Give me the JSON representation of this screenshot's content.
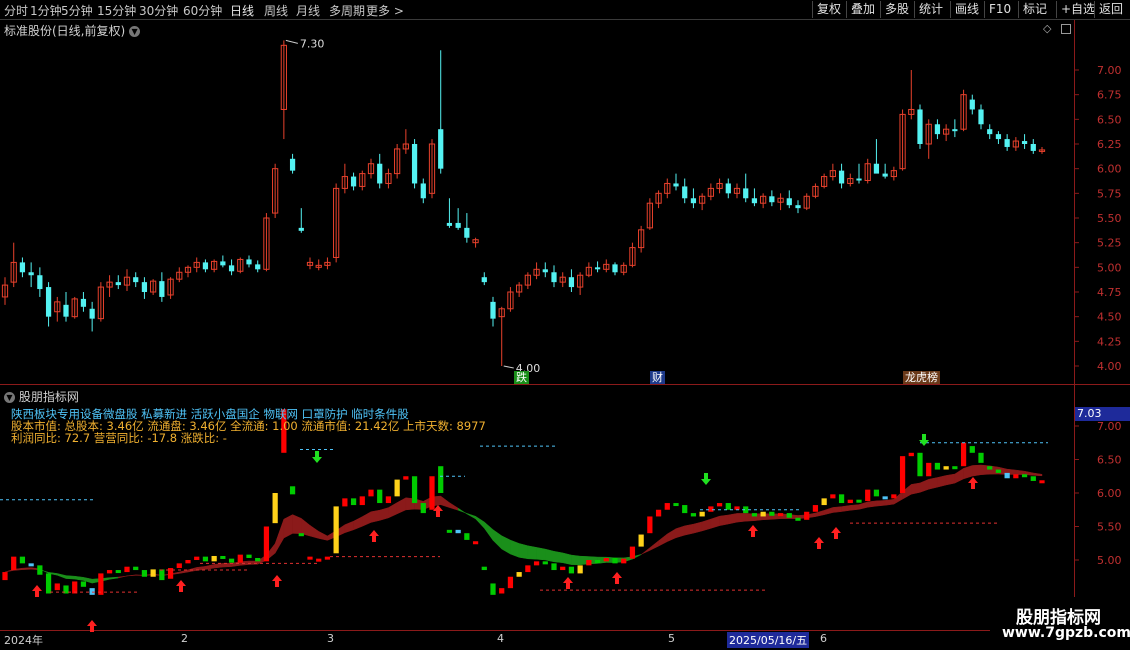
{
  "topbar": {
    "periods": [
      "分时",
      "1分钟",
      "5分钟",
      "15分钟",
      "30分钟",
      "60分钟",
      "日线",
      "周线",
      "月线",
      "多周期",
      "更多 >"
    ],
    "active_period": "日线",
    "tools": [
      "复权",
      "叠加",
      "多股",
      "统计",
      "画线",
      "F10",
      "标记",
      "+自选",
      "返回"
    ]
  },
  "price_panel": {
    "title": "标准股份(日线,前复权)",
    "y_ticks": [
      "7.00",
      "6.75",
      "6.50",
      "6.25",
      "6.00",
      "5.75",
      "5.50",
      "5.25",
      "5.00",
      "4.75",
      "4.50",
      "4.25",
      "4.00"
    ],
    "high_label": "7.30",
    "low_label": "4.00",
    "event_tags": [
      {
        "text": "跌",
        "color": "#1a8f1a"
      },
      {
        "text": "财",
        "color": "#1e3a8a"
      },
      {
        "text": "龙虎榜",
        "color": "#6b3a1a"
      }
    ]
  },
  "indicator_panel": {
    "title": "股朋指标网",
    "current_value": "7.03",
    "y_ticks": [
      "7.00",
      "6.50",
      "6.00",
      "5.50",
      "5.00"
    ],
    "info_lines": [
      {
        "text": "陕西板块专用设备微盘股 私募新进 活跃小盘国企 物联网 口罩防护 临时条件股",
        "color": "#4fc3f7"
      },
      {
        "text": "股本市值: 总股本: 3.46亿 流通盘: 3.46亿 全流通: 1.00 流通市值: 21.42亿 上市天数: 8977",
        "color": "#f0b030"
      },
      {
        "text": "利润同比: 72.7 营营同比: -17.8 涨跌比: -",
        "color": "#f0b030"
      }
    ]
  },
  "date_axis": {
    "labels": [
      "2024年",
      "2",
      "3",
      "4",
      "5",
      "2025/05/16/五",
      "6"
    ]
  },
  "watermark": {
    "title": "股朋指标网",
    "url": "www.7gpzb.com"
  },
  "colors": {
    "up": "#e8412c",
    "down": "#54f2f2",
    "ind_up": "#ff0000",
    "ind_down": "#00cc00",
    "ribbon_red": "#8b1a1a",
    "ribbon_green": "#1a8f1a"
  },
  "chart_data": {
    "type": "candlestick",
    "price_range": [
      3.95,
      7.38
    ],
    "candles": [
      {
        "o": 4.7,
        "h": 4.9,
        "l": 4.62,
        "c": 4.82
      },
      {
        "o": 4.85,
        "h": 5.25,
        "l": 4.8,
        "c": 5.05
      },
      {
        "o": 5.05,
        "h": 5.1,
        "l": 4.9,
        "c": 4.95
      },
      {
        "o": 4.95,
        "h": 5.05,
        "l": 4.8,
        "c": 4.92
      },
      {
        "o": 4.92,
        "h": 5.0,
        "l": 4.7,
        "c": 4.78
      },
      {
        "o": 4.8,
        "h": 4.85,
        "l": 4.4,
        "c": 4.5
      },
      {
        "o": 4.55,
        "h": 4.7,
        "l": 4.45,
        "c": 4.65
      },
      {
        "o": 4.62,
        "h": 4.75,
        "l": 4.45,
        "c": 4.5
      },
      {
        "o": 4.5,
        "h": 4.7,
        "l": 4.48,
        "c": 4.68
      },
      {
        "o": 4.68,
        "h": 4.75,
        "l": 4.55,
        "c": 4.6
      },
      {
        "o": 4.58,
        "h": 4.65,
        "l": 4.35,
        "c": 4.48
      },
      {
        "o": 4.48,
        "h": 4.85,
        "l": 4.45,
        "c": 4.8
      },
      {
        "o": 4.8,
        "h": 4.92,
        "l": 4.7,
        "c": 4.85
      },
      {
        "o": 4.85,
        "h": 4.92,
        "l": 4.78,
        "c": 4.82
      },
      {
        "o": 4.82,
        "h": 4.98,
        "l": 4.76,
        "c": 4.9
      },
      {
        "o": 4.9,
        "h": 4.95,
        "l": 4.8,
        "c": 4.85
      },
      {
        "o": 4.85,
        "h": 4.9,
        "l": 4.68,
        "c": 4.75
      },
      {
        "o": 4.75,
        "h": 4.88,
        "l": 4.72,
        "c": 4.86
      },
      {
        "o": 4.86,
        "h": 4.95,
        "l": 4.65,
        "c": 4.7
      },
      {
        "o": 4.72,
        "h": 4.9,
        "l": 4.68,
        "c": 4.88
      },
      {
        "o": 4.88,
        "h": 5.0,
        "l": 4.85,
        "c": 4.95
      },
      {
        "o": 4.95,
        "h": 5.02,
        "l": 4.9,
        "c": 5.0
      },
      {
        "o": 5.0,
        "h": 5.1,
        "l": 4.95,
        "c": 5.05
      },
      {
        "o": 5.05,
        "h": 5.08,
        "l": 4.95,
        "c": 4.98
      },
      {
        "o": 4.98,
        "h": 5.08,
        "l": 4.95,
        "c": 5.06
      },
      {
        "o": 5.06,
        "h": 5.12,
        "l": 5.0,
        "c": 5.02
      },
      {
        "o": 5.02,
        "h": 5.08,
        "l": 4.92,
        "c": 4.96
      },
      {
        "o": 4.96,
        "h": 5.1,
        "l": 4.94,
        "c": 5.08
      },
      {
        "o": 5.08,
        "h": 5.12,
        "l": 5.0,
        "c": 5.03
      },
      {
        "o": 5.03,
        "h": 5.07,
        "l": 4.95,
        "c": 4.98
      },
      {
        "o": 4.98,
        "h": 5.55,
        "l": 4.96,
        "c": 5.5
      },
      {
        "o": 5.55,
        "h": 6.05,
        "l": 5.5,
        "c": 6.0
      },
      {
        "o": 6.6,
        "h": 7.3,
        "l": 6.3,
        "c": 7.25
      },
      {
        "o": 6.1,
        "h": 6.15,
        "l": 5.95,
        "c": 5.98
      },
      {
        "o": 5.4,
        "h": 5.6,
        "l": 5.35,
        "c": 5.37
      },
      {
        "o": 5.02,
        "h": 5.1,
        "l": 4.98,
        "c": 5.05
      },
      {
        "o": 5.0,
        "h": 5.08,
        "l": 4.97,
        "c": 5.02
      },
      {
        "o": 5.02,
        "h": 5.1,
        "l": 4.98,
        "c": 5.05
      },
      {
        "o": 5.1,
        "h": 5.85,
        "l": 5.05,
        "c": 5.8
      },
      {
        "o": 5.8,
        "h": 6.05,
        "l": 5.75,
        "c": 5.92
      },
      {
        "o": 5.92,
        "h": 5.96,
        "l": 5.78,
        "c": 5.82
      },
      {
        "o": 5.82,
        "h": 5.98,
        "l": 5.78,
        "c": 5.95
      },
      {
        "o": 5.95,
        "h": 6.1,
        "l": 5.9,
        "c": 6.05
      },
      {
        "o": 6.05,
        "h": 6.15,
        "l": 5.8,
        "c": 5.85
      },
      {
        "o": 5.85,
        "h": 6.0,
        "l": 5.8,
        "c": 5.95
      },
      {
        "o": 5.95,
        "h": 6.25,
        "l": 5.9,
        "c": 6.2
      },
      {
        "o": 6.2,
        "h": 6.4,
        "l": 6.15,
        "c": 6.25
      },
      {
        "o": 6.25,
        "h": 6.3,
        "l": 5.8,
        "c": 5.85
      },
      {
        "o": 5.85,
        "h": 5.9,
        "l": 5.65,
        "c": 5.7
      },
      {
        "o": 5.75,
        "h": 6.3,
        "l": 5.7,
        "c": 6.25
      },
      {
        "o": 6.4,
        "h": 7.2,
        "l": 5.95,
        "c": 6.0
      },
      {
        "o": 5.45,
        "h": 5.7,
        "l": 5.4,
        "c": 5.42
      },
      {
        "o": 5.45,
        "h": 5.6,
        "l": 5.38,
        "c": 5.4
      },
      {
        "o": 5.4,
        "h": 5.55,
        "l": 5.25,
        "c": 5.3
      },
      {
        "o": 5.25,
        "h": 5.3,
        "l": 5.2,
        "c": 5.28
      },
      {
        "o": 4.9,
        "h": 4.95,
        "l": 4.82,
        "c": 4.85
      },
      {
        "o": 4.65,
        "h": 4.7,
        "l": 4.4,
        "c": 4.48
      },
      {
        "o": 4.5,
        "h": 4.6,
        "l": 4.0,
        "c": 4.58
      },
      {
        "o": 4.58,
        "h": 4.8,
        "l": 4.55,
        "c": 4.75
      },
      {
        "o": 4.75,
        "h": 4.85,
        "l": 4.7,
        "c": 4.82
      },
      {
        "o": 4.82,
        "h": 4.95,
        "l": 4.78,
        "c": 4.92
      },
      {
        "o": 4.92,
        "h": 5.05,
        "l": 4.88,
        "c": 4.98
      },
      {
        "o": 4.98,
        "h": 5.05,
        "l": 4.9,
        "c": 4.95
      },
      {
        "o": 4.95,
        "h": 5.02,
        "l": 4.8,
        "c": 4.85
      },
      {
        "o": 4.85,
        "h": 4.95,
        "l": 4.8,
        "c": 4.9
      },
      {
        "o": 4.9,
        "h": 4.98,
        "l": 4.75,
        "c": 4.8
      },
      {
        "o": 4.8,
        "h": 4.95,
        "l": 4.72,
        "c": 4.92
      },
      {
        "o": 4.92,
        "h": 5.05,
        "l": 4.9,
        "c": 5.0
      },
      {
        "o": 5.0,
        "h": 5.06,
        "l": 4.95,
        "c": 4.98
      },
      {
        "o": 4.98,
        "h": 5.08,
        "l": 4.95,
        "c": 5.03
      },
      {
        "o": 5.03,
        "h": 5.05,
        "l": 4.92,
        "c": 4.95
      },
      {
        "o": 4.95,
        "h": 5.05,
        "l": 4.92,
        "c": 5.02
      },
      {
        "o": 5.02,
        "h": 5.25,
        "l": 5.0,
        "c": 5.2
      },
      {
        "o": 5.2,
        "h": 5.42,
        "l": 5.15,
        "c": 5.38
      },
      {
        "o": 5.4,
        "h": 5.7,
        "l": 5.38,
        "c": 5.65
      },
      {
        "o": 5.65,
        "h": 5.78,
        "l": 5.6,
        "c": 5.75
      },
      {
        "o": 5.75,
        "h": 5.9,
        "l": 5.7,
        "c": 5.85
      },
      {
        "o": 5.85,
        "h": 5.95,
        "l": 5.78,
        "c": 5.82
      },
      {
        "o": 5.82,
        "h": 5.9,
        "l": 5.65,
        "c": 5.7
      },
      {
        "o": 5.7,
        "h": 5.8,
        "l": 5.6,
        "c": 5.65
      },
      {
        "o": 5.65,
        "h": 5.75,
        "l": 5.58,
        "c": 5.72
      },
      {
        "o": 5.72,
        "h": 5.85,
        "l": 5.68,
        "c": 5.8
      },
      {
        "o": 5.8,
        "h": 5.9,
        "l": 5.75,
        "c": 5.85
      },
      {
        "o": 5.85,
        "h": 5.9,
        "l": 5.7,
        "c": 5.75
      },
      {
        "o": 5.75,
        "h": 5.85,
        "l": 5.7,
        "c": 5.8
      },
      {
        "o": 5.8,
        "h": 5.95,
        "l": 5.66,
        "c": 5.7
      },
      {
        "o": 5.7,
        "h": 5.8,
        "l": 5.62,
        "c": 5.65
      },
      {
        "o": 5.65,
        "h": 5.75,
        "l": 5.6,
        "c": 5.72
      },
      {
        "o": 5.72,
        "h": 5.78,
        "l": 5.62,
        "c": 5.66
      },
      {
        "o": 5.66,
        "h": 5.75,
        "l": 5.58,
        "c": 5.7
      },
      {
        "o": 5.7,
        "h": 5.78,
        "l": 5.6,
        "c": 5.63
      },
      {
        "o": 5.63,
        "h": 5.68,
        "l": 5.55,
        "c": 5.6
      },
      {
        "o": 5.6,
        "h": 5.75,
        "l": 5.58,
        "c": 5.72
      },
      {
        "o": 5.72,
        "h": 5.85,
        "l": 5.7,
        "c": 5.82
      },
      {
        "o": 5.82,
        "h": 5.95,
        "l": 5.8,
        "c": 5.92
      },
      {
        "o": 5.92,
        "h": 6.05,
        "l": 5.88,
        "c": 5.98
      },
      {
        "o": 5.98,
        "h": 6.05,
        "l": 5.8,
        "c": 5.85
      },
      {
        "o": 5.85,
        "h": 5.95,
        "l": 5.82,
        "c": 5.9
      },
      {
        "o": 5.9,
        "h": 6.05,
        "l": 5.85,
        "c": 5.88
      },
      {
        "o": 5.88,
        "h": 6.1,
        "l": 5.85,
        "c": 6.05
      },
      {
        "o": 6.05,
        "h": 6.3,
        "l": 6.0,
        "c": 5.95
      },
      {
        "o": 5.95,
        "h": 6.05,
        "l": 5.9,
        "c": 5.92
      },
      {
        "o": 5.92,
        "h": 6.02,
        "l": 5.88,
        "c": 5.98
      },
      {
        "o": 6.0,
        "h": 6.6,
        "l": 5.98,
        "c": 6.55
      },
      {
        "o": 6.55,
        "h": 7.0,
        "l": 6.5,
        "c": 6.6
      },
      {
        "o": 6.6,
        "h": 6.65,
        "l": 6.2,
        "c": 6.25
      },
      {
        "o": 6.25,
        "h": 6.5,
        "l": 6.1,
        "c": 6.45
      },
      {
        "o": 6.45,
        "h": 6.5,
        "l": 6.3,
        "c": 6.35
      },
      {
        "o": 6.35,
        "h": 6.45,
        "l": 6.28,
        "c": 6.4
      },
      {
        "o": 6.4,
        "h": 6.5,
        "l": 6.32,
        "c": 6.38
      },
      {
        "o": 6.4,
        "h": 6.8,
        "l": 6.38,
        "c": 6.75
      },
      {
        "o": 6.7,
        "h": 6.75,
        "l": 6.55,
        "c": 6.6
      },
      {
        "o": 6.6,
        "h": 6.65,
        "l": 6.4,
        "c": 6.45
      },
      {
        "o": 6.4,
        "h": 6.45,
        "l": 6.3,
        "c": 6.35
      },
      {
        "o": 6.35,
        "h": 6.38,
        "l": 6.25,
        "c": 6.3
      },
      {
        "o": 6.3,
        "h": 6.35,
        "l": 6.18,
        "c": 6.22
      },
      {
        "o": 6.22,
        "h": 6.32,
        "l": 6.18,
        "c": 6.28
      },
      {
        "o": 6.28,
        "h": 6.35,
        "l": 6.2,
        "c": 6.25
      },
      {
        "o": 6.25,
        "h": 6.3,
        "l": 6.15,
        "c": 6.18
      },
      {
        "o": 6.18,
        "h": 6.22,
        "l": 6.15,
        "c": 6.19
      }
    ]
  }
}
